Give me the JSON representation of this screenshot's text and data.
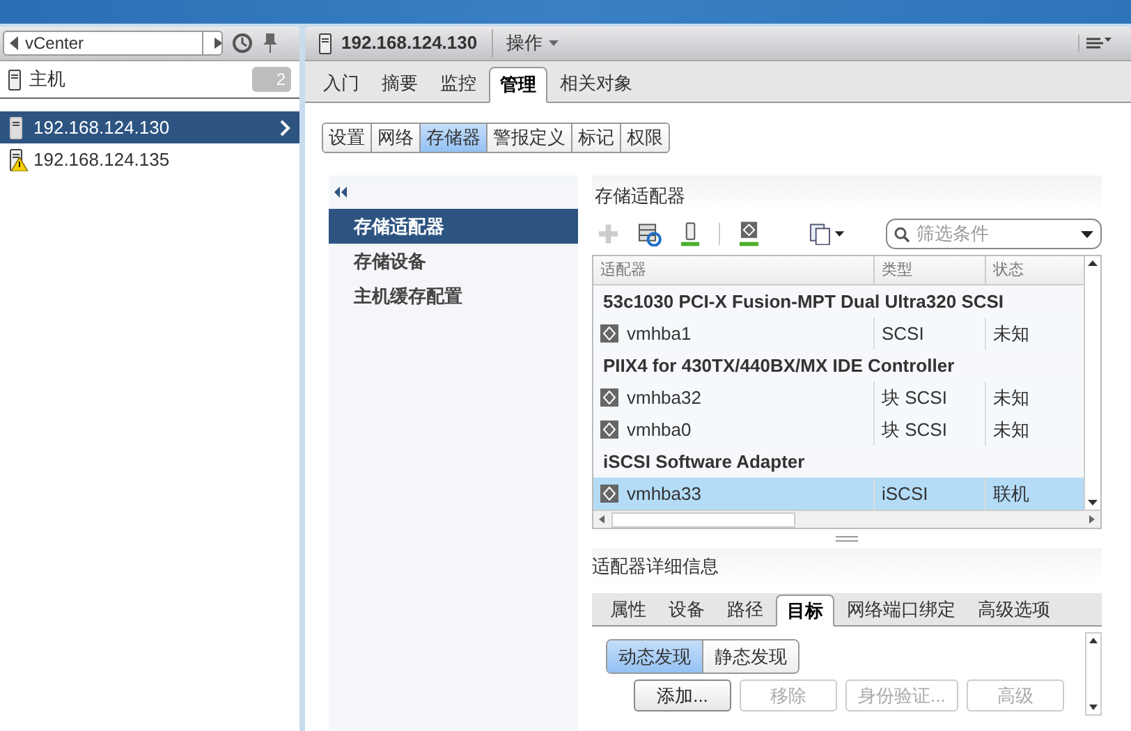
{
  "navigator": {
    "history_field": "vCenter",
    "category": {
      "label": "主机",
      "count": "2"
    },
    "items": [
      {
        "label": "192.168.124.130",
        "selected": true,
        "warning": false
      },
      {
        "label": "192.168.124.135",
        "selected": false,
        "warning": true
      }
    ]
  },
  "object_header": {
    "title": "192.168.124.130",
    "actions": "操作"
  },
  "tabs": [
    {
      "label": "入门",
      "selected": false
    },
    {
      "label": "摘要",
      "selected": false
    },
    {
      "label": "监控",
      "selected": false
    },
    {
      "label": "管理",
      "selected": true
    },
    {
      "label": "相关对象",
      "selected": false
    }
  ],
  "subtabs": [
    {
      "label": "设置",
      "selected": false
    },
    {
      "label": "网络",
      "selected": false
    },
    {
      "label": "存储器",
      "selected": true
    },
    {
      "label": "警报定义",
      "selected": false
    },
    {
      "label": "标记",
      "selected": false
    },
    {
      "label": "权限",
      "selected": false
    }
  ],
  "side_menu": [
    {
      "label": "存储适配器",
      "selected": true
    },
    {
      "label": "存储设备",
      "selected": false
    },
    {
      "label": "主机缓存配置",
      "selected": false
    }
  ],
  "adapters": {
    "title": "存储适配器",
    "filter_placeholder": "筛选条件",
    "columns": [
      "适配器",
      "类型",
      "状态"
    ],
    "rows": [
      {
        "kind": "group",
        "label": "53c1030 PCI-X Fusion-MPT Dual Ultra320 SCSI"
      },
      {
        "kind": "adapter",
        "name": "vmhba1",
        "type": "SCSI",
        "status": "未知",
        "selected": false
      },
      {
        "kind": "group",
        "label": "PIIX4 for 430TX/440BX/MX IDE Controller"
      },
      {
        "kind": "adapter",
        "name": "vmhba32",
        "type": "块 SCSI",
        "status": "未知",
        "selected": false
      },
      {
        "kind": "adapter",
        "name": "vmhba0",
        "type": "块 SCSI",
        "status": "未知",
        "selected": false
      },
      {
        "kind": "group",
        "label": "iSCSI Software Adapter"
      },
      {
        "kind": "adapter",
        "name": "vmhba33",
        "type": "iSCSI",
        "status": "联机",
        "selected": true
      }
    ]
  },
  "details": {
    "title": "适配器详细信息",
    "tabs": [
      {
        "label": "属性",
        "selected": false
      },
      {
        "label": "设备",
        "selected": false
      },
      {
        "label": "路径",
        "selected": false
      },
      {
        "label": "目标",
        "selected": true
      },
      {
        "label": "网络端口绑定",
        "selected": false
      },
      {
        "label": "高级选项",
        "selected": false
      }
    ],
    "discovery": [
      {
        "label": "动态发现",
        "selected": true
      },
      {
        "label": "静态发现",
        "selected": false
      }
    ],
    "buttons": [
      {
        "label": "添加...",
        "disabled": false
      },
      {
        "label": "移除",
        "disabled": true
      },
      {
        "label": "身份验证...",
        "disabled": true
      },
      {
        "label": "高级",
        "disabled": true
      }
    ]
  }
}
